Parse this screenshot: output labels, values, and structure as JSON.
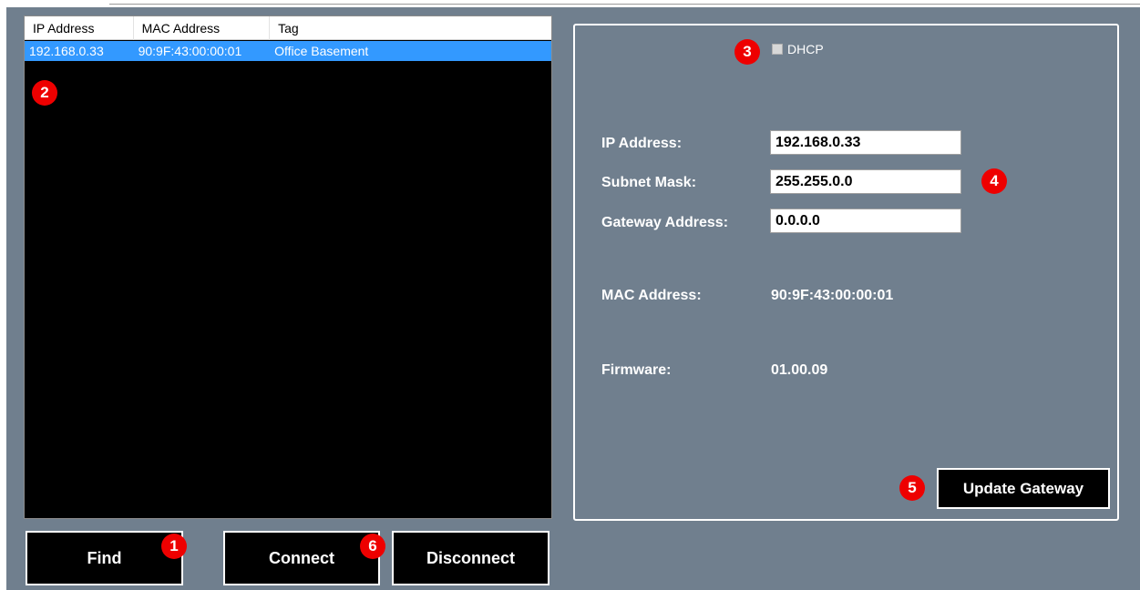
{
  "list": {
    "columns": [
      "IP Address",
      "MAC Address",
      "Tag"
    ],
    "rows": [
      {
        "ip": "192.168.0.33",
        "mac": "90:9F:43:00:00:01",
        "tag": "Office Basement"
      }
    ]
  },
  "buttons": {
    "find": "Find",
    "connect": "Connect",
    "disconnect": "Disconnect",
    "update_gateway": "Update Gateway"
  },
  "settings": {
    "dhcp_label": "DHCP",
    "dhcp_checked": false,
    "ip_label": "IP Address:",
    "ip_value": "192.168.0.33",
    "subnet_label": "Subnet Mask:",
    "subnet_value": "255.255.0.0",
    "gateway_label": "Gateway Address:",
    "gateway_value": "0.0.0.0",
    "mac_label": "MAC Address:",
    "mac_value": "90:9F:43:00:00:01",
    "firmware_label": "Firmware:",
    "firmware_value": "01.00.09"
  },
  "annotations": [
    "1",
    "2",
    "3",
    "4",
    "5",
    "6"
  ],
  "colors": {
    "background": "#707f8e",
    "selection": "#3399ff",
    "badge": "#ee0000"
  }
}
